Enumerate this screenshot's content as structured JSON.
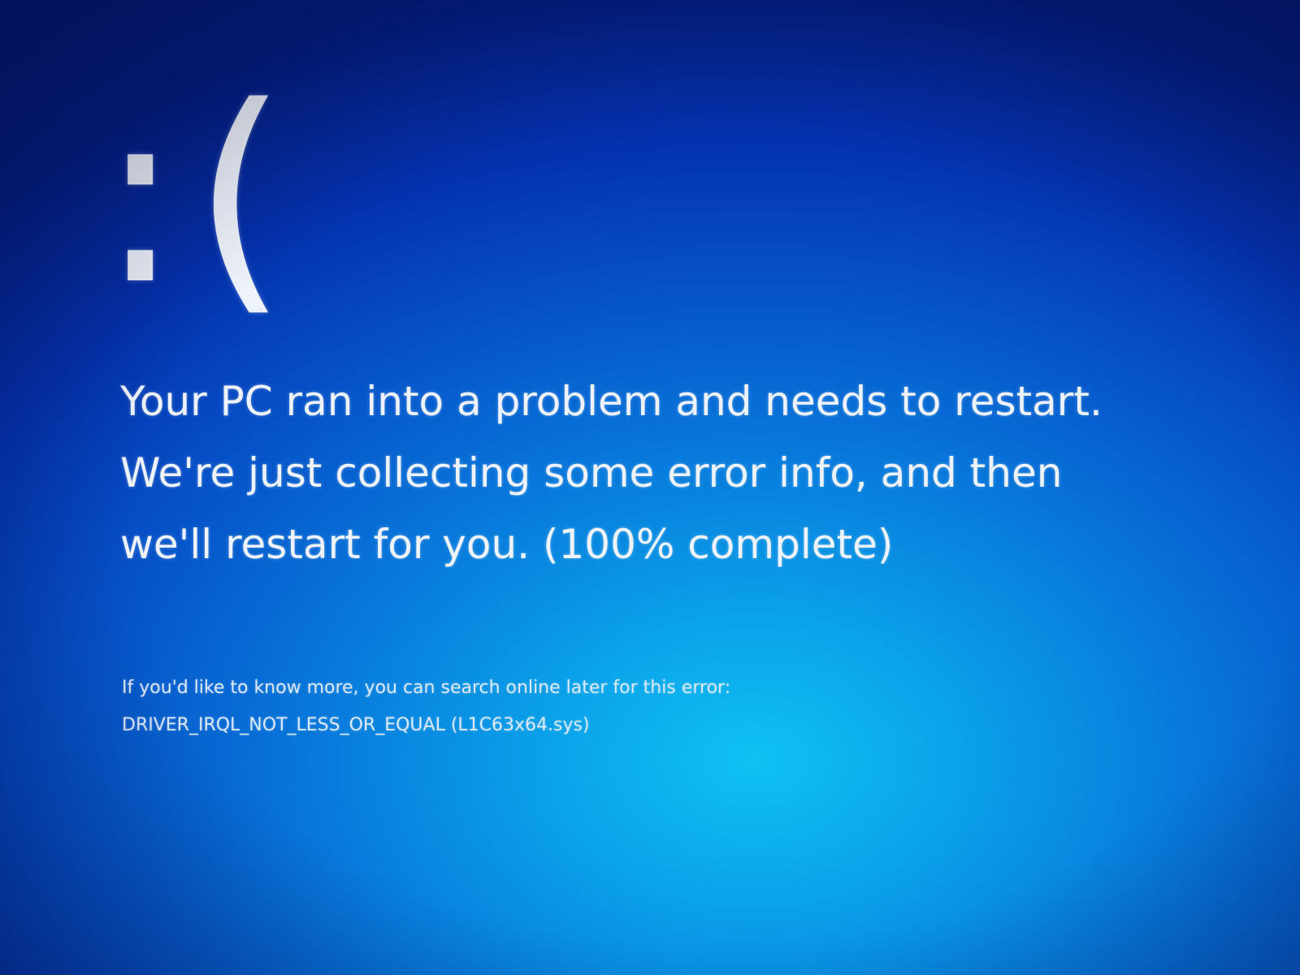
{
  "screen": {
    "emoticon": ":(",
    "message_lines": [
      "Your PC ran into a problem and needs to restart.",
      "We're just collecting some error info, and then",
      "we'll restart for you. (100% complete)"
    ],
    "progress_percent": 100,
    "info_line": "If you'd like to know more, you can search online later for this error:",
    "error_code": "DRIVER_IRQL_NOT_LESS_OR_EQUAL (L1C63x64.sys)"
  },
  "colors": {
    "background_bright": "#0fc1f3",
    "background_mid": "#0878db",
    "background_dark": "#041e82",
    "text": "#eef3fb"
  }
}
